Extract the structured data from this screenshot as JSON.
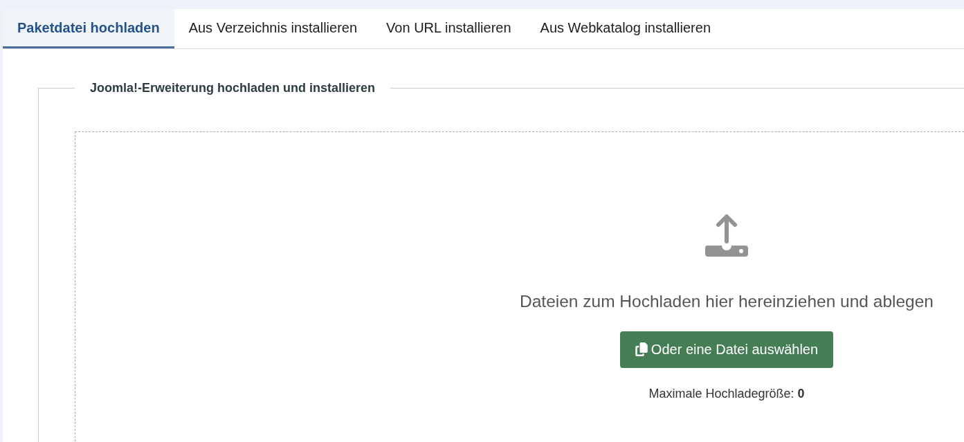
{
  "tabs": [
    {
      "label": "Paketdatei hochladen",
      "selected": true
    },
    {
      "label": "Aus Verzeichnis installieren",
      "selected": false
    },
    {
      "label": "Von URL installieren",
      "selected": false
    },
    {
      "label": "Aus Webkatalog installieren",
      "selected": false
    }
  ],
  "upload": {
    "legend": "Joomla!-Erweiterung hochladen und installieren",
    "drop_text": "Dateien zum Hochladen hier hereinziehen und ablegen",
    "button": "Oder eine Datei auswählen",
    "max_size": "Maximale Hochladegröße: **0**"
  }
}
